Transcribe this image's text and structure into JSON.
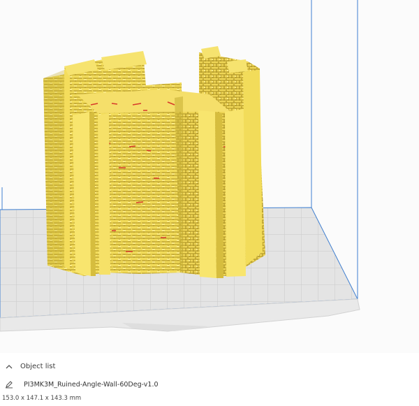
{
  "object_list": {
    "toggle_icon": "chevron-up-icon",
    "label": "Object list"
  },
  "model": {
    "edit_icon": "pencil-icon",
    "name": "PI3MK3M_Ruined-Angle-Wall-60Deg-v1.0",
    "dimensions": "153.0 x 147.1 x 143.3 mm"
  },
  "colors": {
    "model": "#f5e264",
    "model_shadow": "#c9b237",
    "overhang": "#d73a2a",
    "build_plate": "#dcdcdc",
    "grid": "#c8c8c8",
    "volume_edge": "#3f7fd0"
  }
}
